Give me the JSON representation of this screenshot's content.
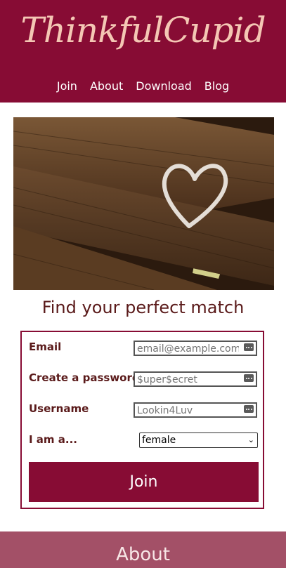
{
  "header": {
    "logo": "ThinkfulCupid",
    "nav": [
      "Join",
      "About",
      "Download",
      "Blog"
    ]
  },
  "hero": {
    "icon": "chalk-heart-on-wood-bench-photo"
  },
  "main": {
    "title": "Find your perfect match",
    "form": {
      "email_label": "Email",
      "email_placeholder": "email@example.com",
      "password_label": "Create a password",
      "password_placeholder": "$uper$ecret",
      "username_label": "Username",
      "username_placeholder": "Lookin4Luv",
      "gender_label": "I am a...",
      "gender_value": "female",
      "join_label": "Join"
    }
  },
  "footer": {
    "about_label": "About"
  },
  "colors": {
    "brand": "#870c34",
    "logo": "#f4c7b4",
    "about_bar": "#a35067"
  }
}
